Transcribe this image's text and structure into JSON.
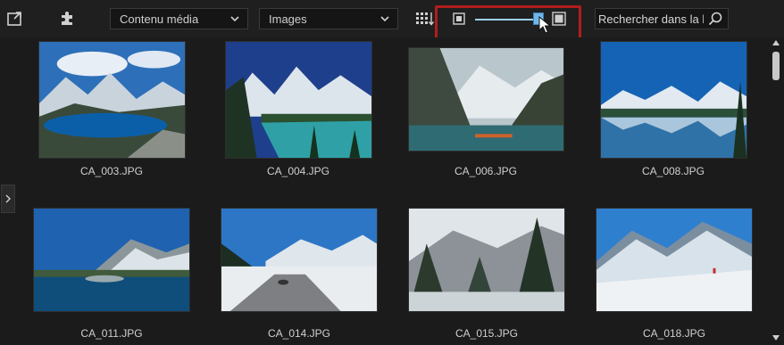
{
  "toolbar": {
    "import_icon": "import-icon",
    "plugin_icon": "puzzle-icon",
    "media_dropdown": {
      "value": "Contenu média"
    },
    "type_dropdown": {
      "value": "Images"
    },
    "sort_icon": "grid-sort-icon",
    "thumb_size_slider": {
      "level_percent": 100
    },
    "search": {
      "placeholder": "Rechercher dans la b"
    }
  },
  "media": [
    {
      "name": "CA_003.JPG"
    },
    {
      "name": "CA_004.JPG"
    },
    {
      "name": "CA_006.JPG"
    },
    {
      "name": "CA_008.JPG"
    },
    {
      "name": "CA_011.JPG"
    },
    {
      "name": "CA_014.JPG"
    },
    {
      "name": "CA_015.JPG"
    },
    {
      "name": "CA_018.JPG"
    }
  ],
  "colors": {
    "highlight": "#b11d1d",
    "slider_accent": "#6fb7ea",
    "background": "#1b1b1b"
  }
}
